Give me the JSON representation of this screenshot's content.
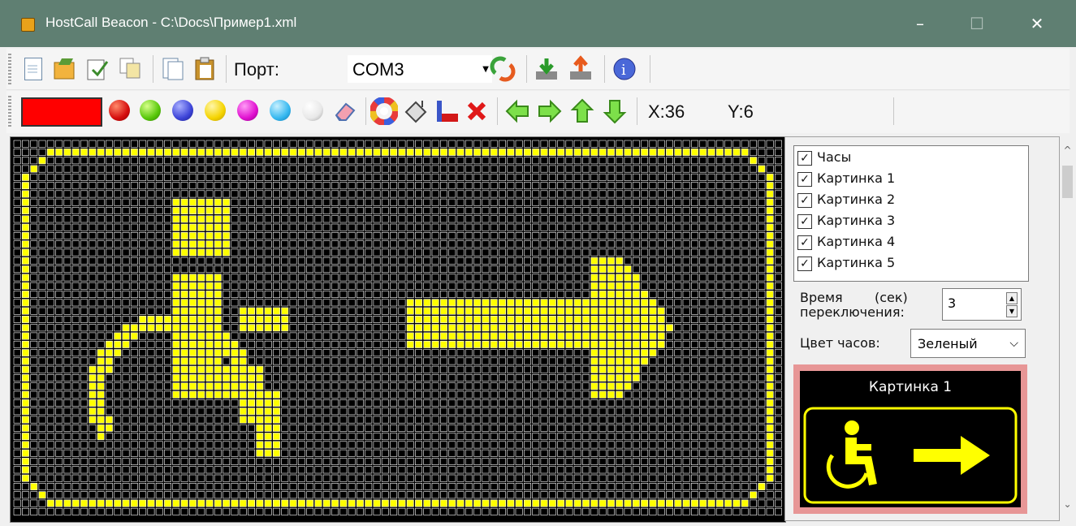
{
  "window": {
    "title": "HostCall Beacon - C:\\Docs\\Пример1.xml",
    "minimize": "–",
    "maximize": "☐",
    "close": "✕"
  },
  "toolbar1": {
    "buttons": [
      "new-document-icon",
      "open-document-icon",
      "edit-document-icon",
      "copy-icon",
      "document-icon",
      "paste-icon"
    ],
    "port_label": "Порт:",
    "port_value": "COM3",
    "actions": [
      "refresh-icon",
      "download-icon",
      "upload-icon",
      "info-icon"
    ]
  },
  "toolbar2": {
    "current_color": "#ff0000",
    "palette": [
      {
        "name": "red",
        "color": "#e11"
      },
      {
        "name": "green",
        "color": "#58c80a"
      },
      {
        "name": "blue",
        "color": "#3d44d8"
      },
      {
        "name": "yellow",
        "color": "#f5d400"
      },
      {
        "name": "magenta",
        "color": "#e010d0"
      },
      {
        "name": "cyan",
        "color": "#36b8f0"
      },
      {
        "name": "white",
        "color": "#f2f2f2"
      }
    ],
    "x_label": "X:36",
    "y_label": "Y:6"
  },
  "editor": {
    "led_color": "#ffff00",
    "background": "#000000"
  },
  "side": {
    "items": [
      {
        "label": "Часы",
        "checked": true
      },
      {
        "label": "Картинка 1",
        "checked": true
      },
      {
        "label": "Картинка 2",
        "checked": true
      },
      {
        "label": "Картинка 3",
        "checked": true
      },
      {
        "label": "Картинка 4",
        "checked": true
      },
      {
        "label": "Картинка 5",
        "checked": true
      }
    ],
    "check_mark": "✓",
    "time_label_1": "Время",
    "time_label_unit": "(сек)",
    "time_label_2": "переключения:",
    "time_value": "3",
    "clock_color_label": "Цвет часов:",
    "clock_color_value": "Зеленый",
    "preview_title": "Картинка 1"
  }
}
